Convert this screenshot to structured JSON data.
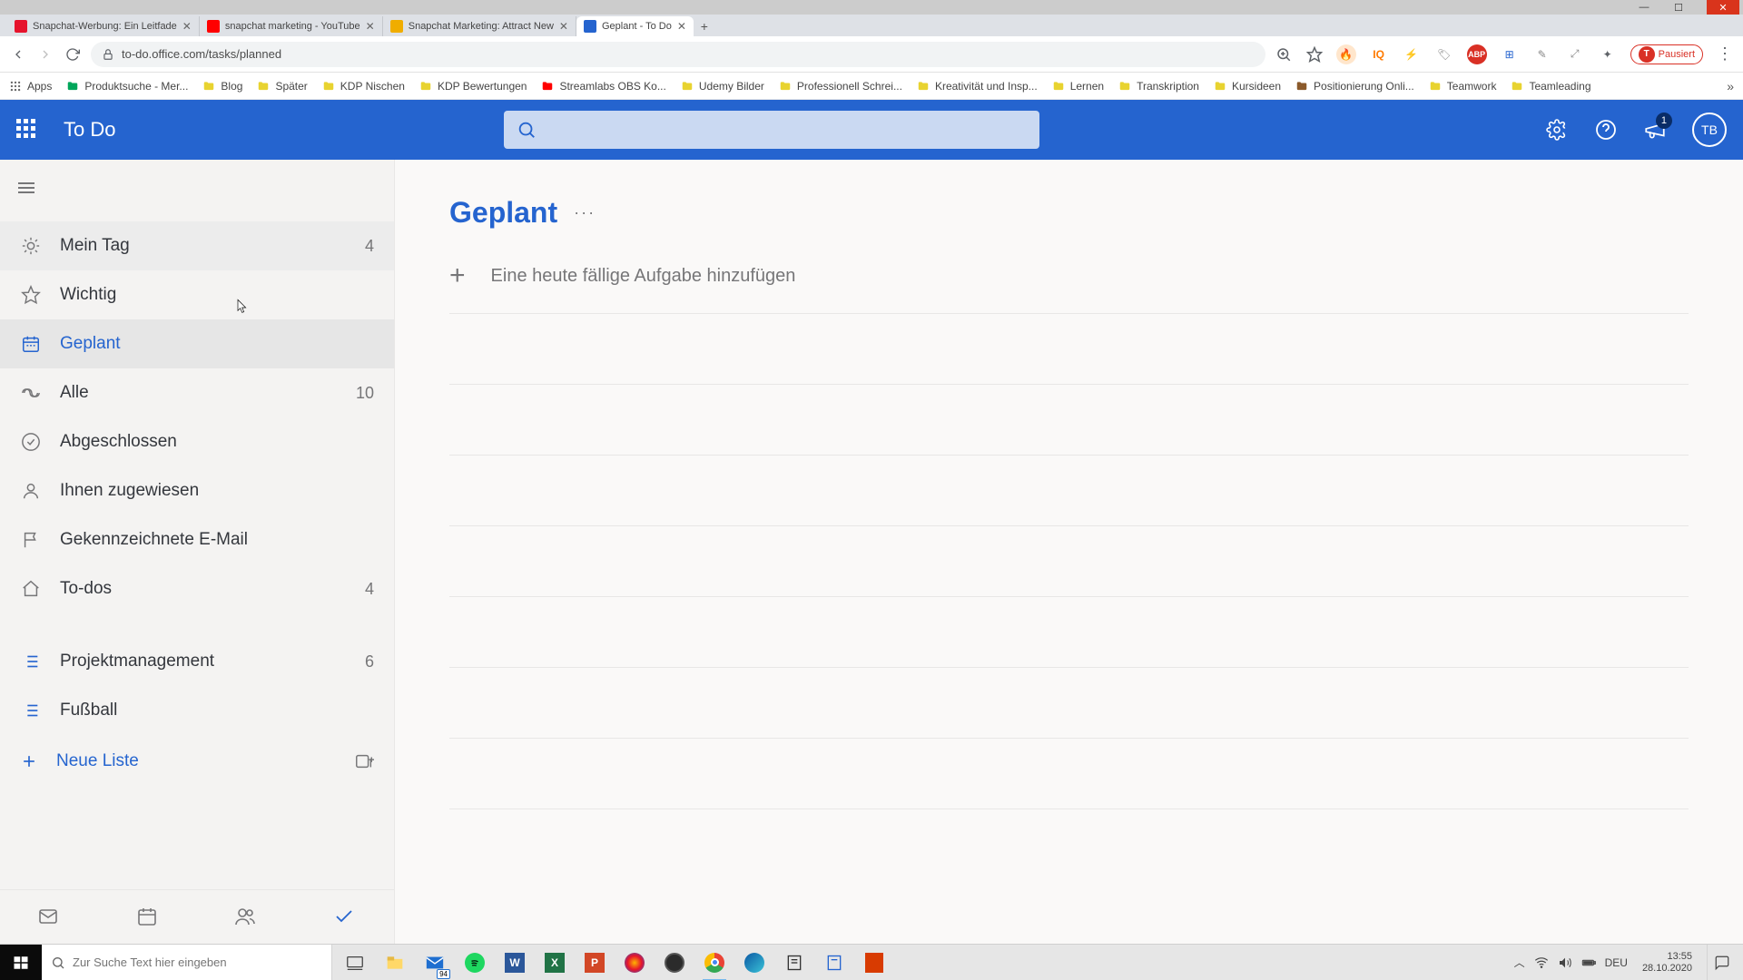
{
  "window": {
    "minimize": "—",
    "maximize": "☐",
    "close": "✕"
  },
  "tabs": [
    {
      "title": "Snapchat-Werbung: Ein Leitfade",
      "favcolor": "#e6132c"
    },
    {
      "title": "snapchat marketing - YouTube",
      "favcolor": "#ff0000"
    },
    {
      "title": "Snapchat Marketing: Attract New",
      "favcolor": "#f0ad00"
    },
    {
      "title": "Geplant - To Do",
      "favcolor": "#2564cf",
      "active": true
    }
  ],
  "url": "to-do.office.com/tasks/planned",
  "profile": {
    "label": "Pausiert",
    "initial": "T"
  },
  "bookmarks": [
    {
      "label": "Apps",
      "type": "apps"
    },
    {
      "label": "Produktsuche - Mer...",
      "color": "#00a65a"
    },
    {
      "label": "Blog",
      "color": "#e8d330"
    },
    {
      "label": "Später",
      "color": "#e8d330"
    },
    {
      "label": "KDP Nischen",
      "color": "#e8d330"
    },
    {
      "label": "KDP Bewertungen",
      "color": "#e8d330"
    },
    {
      "label": "Streamlabs OBS Ko...",
      "color": "#ff0000"
    },
    {
      "label": "Udemy Bilder",
      "color": "#e8d330"
    },
    {
      "label": "Professionell Schrei...",
      "color": "#e8d330"
    },
    {
      "label": "Kreativität und Insp...",
      "color": "#e8d330"
    },
    {
      "label": "Lernen",
      "color": "#e8d330"
    },
    {
      "label": "Transkription",
      "color": "#e8d330"
    },
    {
      "label": "Kursideen",
      "color": "#e8d330"
    },
    {
      "label": "Positionierung Onli...",
      "color": "#8b5a2b"
    },
    {
      "label": "Teamwork",
      "color": "#e8d330"
    },
    {
      "label": "Teamleading",
      "color": "#e8d330"
    }
  ],
  "app": {
    "title": "To Do",
    "account_initials": "TB",
    "notifications_badge": "1",
    "main_title": "Geplant",
    "add_task_prompt": "Eine heute fällige Aufgabe hinzufügen",
    "new_list": "Neue Liste",
    "nav": [
      {
        "icon": "sun",
        "label": "Mein Tag",
        "count": "4",
        "hovered": true
      },
      {
        "icon": "star",
        "label": "Wichtig"
      },
      {
        "icon": "calendar",
        "label": "Geplant",
        "active": true
      },
      {
        "icon": "infinity",
        "label": "Alle",
        "count": "10"
      },
      {
        "icon": "check",
        "label": "Abgeschlossen"
      },
      {
        "icon": "user",
        "label": "Ihnen zugewiesen"
      },
      {
        "icon": "flag",
        "label": "Gekennzeichnete E-Mail"
      },
      {
        "icon": "home",
        "label": "To-dos",
        "count": "4"
      }
    ],
    "custom_lists": [
      {
        "label": "Projektmanagement",
        "count": "6"
      },
      {
        "label": "Fußball"
      }
    ]
  },
  "taskbar": {
    "search_placeholder": "Zur Suche Text hier eingeben",
    "lang": "DEU",
    "time": "13:55",
    "date": "28.10.2020",
    "mail_badge": "94"
  }
}
